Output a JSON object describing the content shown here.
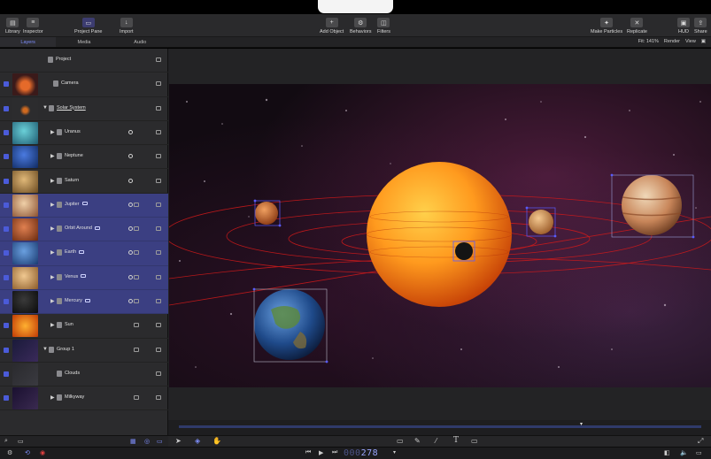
{
  "toolbar": {
    "left": [
      {
        "label": "Library",
        "icon": "library-icon"
      },
      {
        "label": "Inspector",
        "icon": "inspector-icon"
      },
      {
        "label": "Project Pane",
        "icon": "project-pane-icon"
      },
      {
        "label": "Import",
        "icon": "import-icon"
      }
    ],
    "center": [
      {
        "label": "Add Object",
        "icon": "plus-icon"
      },
      {
        "label": "Behaviors",
        "icon": "behaviors-icon"
      },
      {
        "label": "Filters",
        "icon": "filters-icon"
      }
    ],
    "right": [
      {
        "label": "Make Particles",
        "icon": "particles-icon"
      },
      {
        "label": "Replicate",
        "icon": "replicate-icon"
      },
      {
        "label": "HUD",
        "icon": "hud-icon"
      },
      {
        "label": "Share",
        "icon": "share-icon"
      }
    ]
  },
  "tabs": [
    "Layers",
    "Media",
    "Audio"
  ],
  "viewer": {
    "fit": "Fit: 141%",
    "render": "Render",
    "view": "View"
  },
  "layers": [
    {
      "name": "Project",
      "indent": 0
    },
    {
      "name": "Camera",
      "indent": 0
    },
    {
      "name": "Solar System",
      "indent": 0,
      "expanded": true
    },
    {
      "name": "Uranus",
      "indent": 1
    },
    {
      "name": "Neptune",
      "indent": 1
    },
    {
      "name": "Saturn",
      "indent": 1
    },
    {
      "name": "Jupiter",
      "indent": 1,
      "selected": true
    },
    {
      "name": "Orbit Around",
      "indent": 1,
      "selected": true
    },
    {
      "name": "Earth",
      "indent": 1,
      "selected": true
    },
    {
      "name": "Venus",
      "indent": 1,
      "selected": true
    },
    {
      "name": "Mercury",
      "indent": 1,
      "selected": true
    },
    {
      "name": "Sun",
      "indent": 1
    },
    {
      "name": "Group 1",
      "indent": 0,
      "expanded": true
    },
    {
      "name": "Clouds",
      "indent": 1
    },
    {
      "name": "Milkyway",
      "indent": 1
    }
  ],
  "timecode": {
    "dim": "000",
    "frame": "278"
  },
  "colors": {
    "accent": "#6f7cff",
    "selection": "#3b3f82",
    "orbit": "#d21a1a",
    "handle": "#5a5cff"
  }
}
